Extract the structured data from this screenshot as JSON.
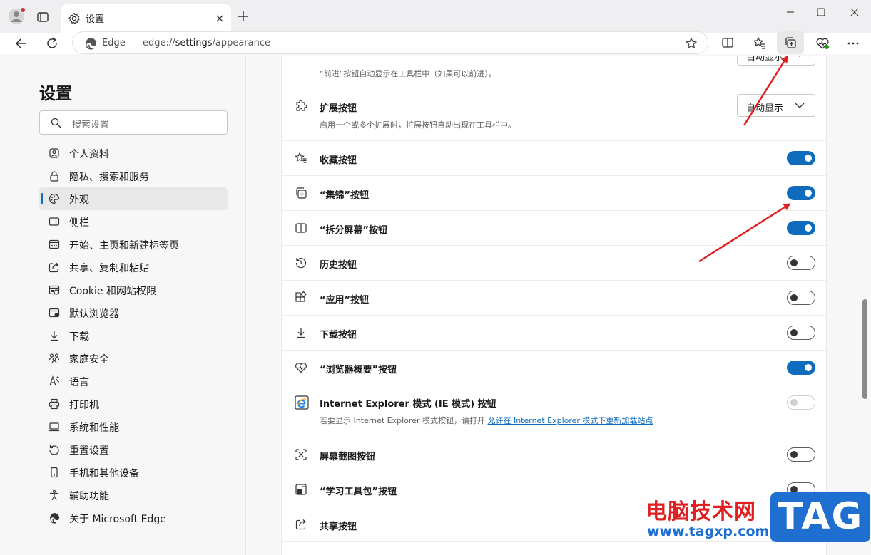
{
  "tab": {
    "title": "设置"
  },
  "address": {
    "site": "Edge",
    "url_scheme": "edge://",
    "url_host": "settings",
    "url_path": "/appearance"
  },
  "sidebar": {
    "heading": "设置",
    "search_placeholder": "搜索设置",
    "items": [
      {
        "label": "个人资料",
        "icon": "profile-icon"
      },
      {
        "label": "隐私、搜索和服务",
        "icon": "lock-icon"
      },
      {
        "label": "外观",
        "icon": "palette-icon",
        "active": true
      },
      {
        "label": "侧栏",
        "icon": "sidebar-icon"
      },
      {
        "label": "开始、主页和新建标签页",
        "icon": "home-icon"
      },
      {
        "label": "共享、复制和粘贴",
        "icon": "share-icon"
      },
      {
        "label": "Cookie 和网站权限",
        "icon": "cookie-icon"
      },
      {
        "label": "默认浏览器",
        "icon": "browser-icon"
      },
      {
        "label": "下载",
        "icon": "download-icon"
      },
      {
        "label": "家庭安全",
        "icon": "family-icon"
      },
      {
        "label": "语言",
        "icon": "language-icon"
      },
      {
        "label": "打印机",
        "icon": "printer-icon"
      },
      {
        "label": "系统和性能",
        "icon": "system-icon"
      },
      {
        "label": "重置设置",
        "icon": "reset-icon"
      },
      {
        "label": "手机和其他设备",
        "icon": "phone-icon"
      },
      {
        "label": "辅助功能",
        "icon": "accessibility-icon"
      },
      {
        "label": "关于 Microsoft Edge",
        "icon": "edge-icon"
      }
    ]
  },
  "settings": {
    "forward_desc": "“前进”按钮自动显示在工具栏中（如果可以前进）。",
    "forward_value": "自动显示",
    "ext_label": "扩展按钮",
    "ext_desc": "启用一个或多个扩展时，扩展按钮自动出现在工具栏中。",
    "ext_value": "自动显示",
    "rows": [
      {
        "label": "收藏按钮",
        "state": "on"
      },
      {
        "label": "“集锦”按钮",
        "state": "on"
      },
      {
        "label": "“拆分屏幕”按钮",
        "state": "on"
      },
      {
        "label": "历史按钮",
        "state": "off"
      },
      {
        "label": "“应用”按钮",
        "state": "off"
      },
      {
        "label": "下载按钮",
        "state": "off"
      },
      {
        "label": "“浏览器概要”按钮",
        "state": "on"
      }
    ],
    "ie_label": "Internet Explorer 模式 (IE 模式) 按钮",
    "ie_desc": "若要显示 Internet Explorer 模式按钮，请打开",
    "ie_link": "允许在 Internet Explorer 模式下重新加载站点",
    "screenshot_label": "屏幕截图按钮",
    "learning_label": "“学习工具包”按钮",
    "share_label": "共享按钮"
  },
  "watermark": {
    "cn": "电脑技术网",
    "url": "www.tagxp.com",
    "tag": "TAG"
  },
  "colors": {
    "accent": "#0f6cbd",
    "arrow": "#e02020"
  }
}
